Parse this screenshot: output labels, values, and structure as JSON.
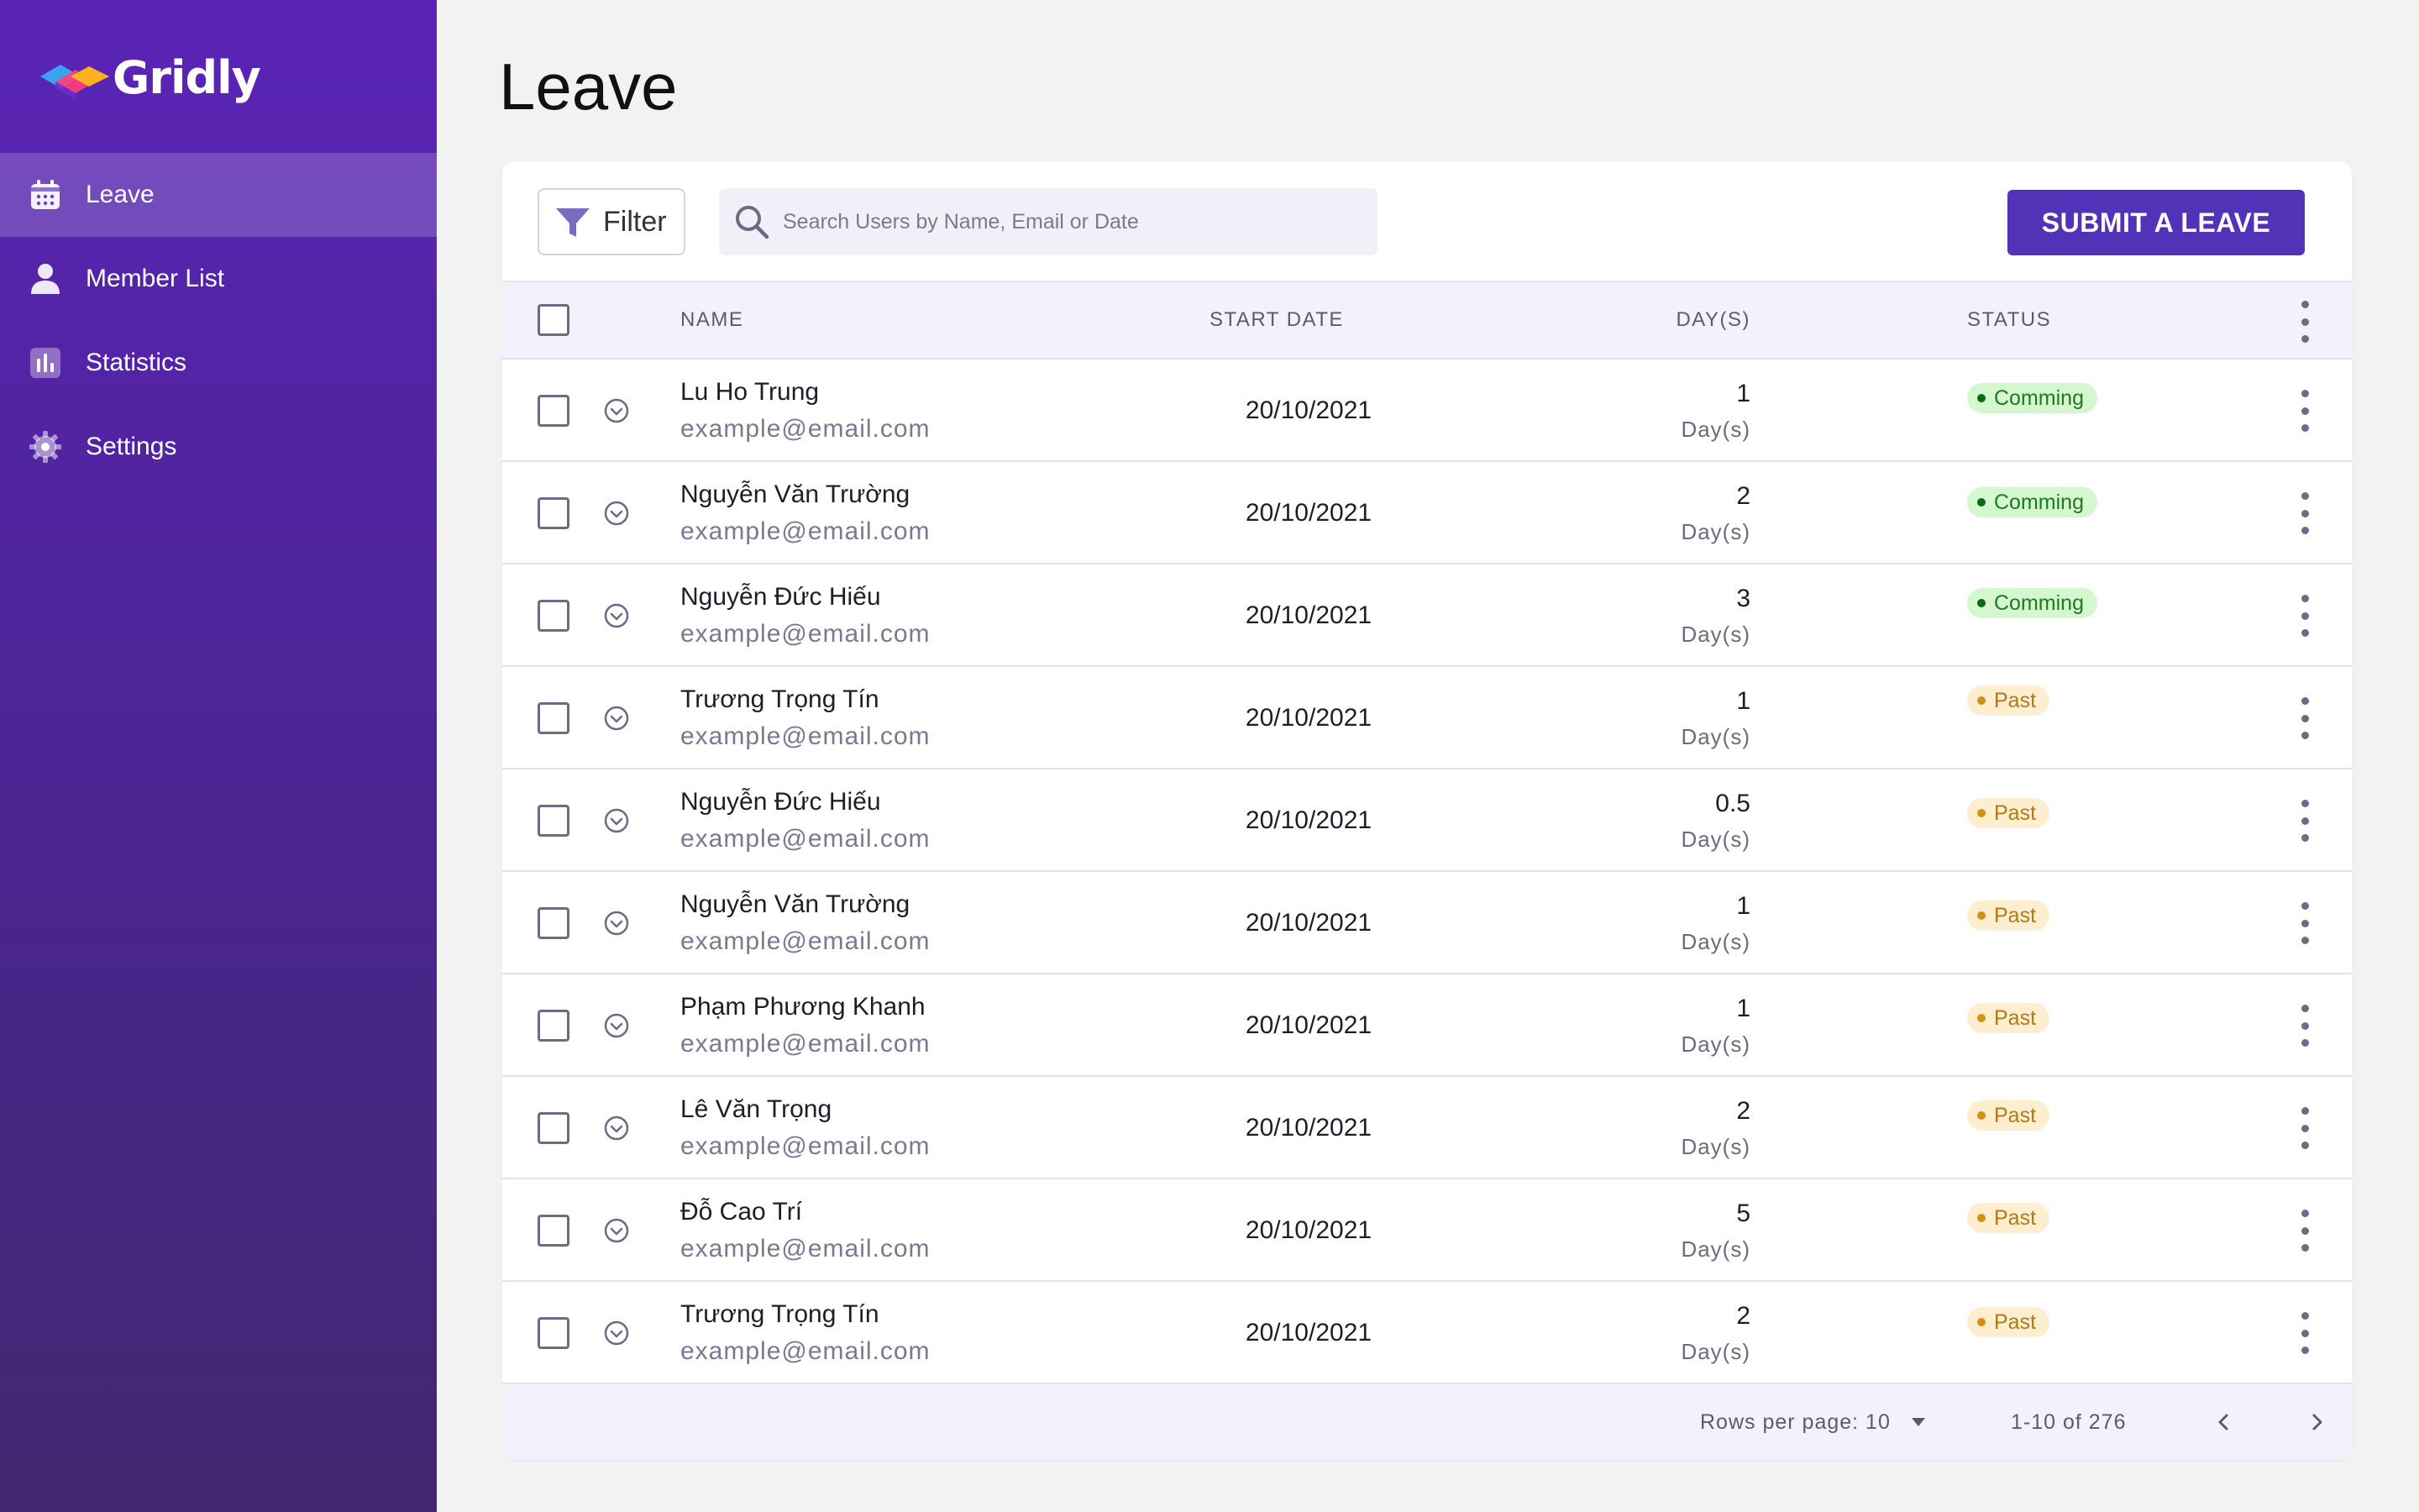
{
  "app": {
    "name": "Gridly"
  },
  "sidebar": {
    "items": [
      {
        "label": "Leave",
        "icon": "calendar-icon",
        "active": true
      },
      {
        "label": "Member List",
        "icon": "user-icon",
        "active": false
      },
      {
        "label": "Statistics",
        "icon": "bar-chart-icon",
        "active": false
      },
      {
        "label": "Settings",
        "icon": "gear-icon",
        "active": false
      }
    ]
  },
  "page": {
    "title": "Leave"
  },
  "toolbar": {
    "filter_label": "Filter",
    "search_placeholder": "Search Users by Name, Email or Date",
    "submit_label": "SUBMIT A LEAVE"
  },
  "table": {
    "columns": {
      "name": "NAME",
      "start_date": "START DATE",
      "days": "DAY(S)",
      "status": "STATUS"
    },
    "rows": [
      {
        "name": "Lu Ho Trung",
        "email": "example@email.com",
        "start_date": "20/10/2021",
        "days": "1",
        "days_unit": "Day(s)",
        "status": "Comming"
      },
      {
        "name": "Nguyễn Văn Trường",
        "email": "example@email.com",
        "start_date": "20/10/2021",
        "days": "2",
        "days_unit": "Day(s)",
        "status": "Comming"
      },
      {
        "name": "Nguyễn Đức Hiếu",
        "email": "example@email.com",
        "start_date": "20/10/2021",
        "days": "3",
        "days_unit": "Day(s)",
        "status": "Comming"
      },
      {
        "name": "Trương Trọng Tín",
        "email": "example@email.com",
        "start_date": "20/10/2021",
        "days": "1",
        "days_unit": "Day(s)",
        "status": "Past"
      },
      {
        "name": "Nguyễn Đức Hiếu",
        "email": "example@email.com",
        "start_date": "20/10/2021",
        "days": "0.5",
        "days_unit": "Day(s)",
        "status": "Past"
      },
      {
        "name": "Nguyễn Văn Trường",
        "email": "example@email.com",
        "start_date": "20/10/2021",
        "days": "1",
        "days_unit": "Day(s)",
        "status": "Past"
      },
      {
        "name": "Phạm Phương Khanh",
        "email": "example@email.com",
        "start_date": "20/10/2021",
        "days": "1",
        "days_unit": "Day(s)",
        "status": "Past"
      },
      {
        "name": "Lê Văn Trọng",
        "email": "example@email.com",
        "start_date": "20/10/2021",
        "days": "2",
        "days_unit": "Day(s)",
        "status": "Past"
      },
      {
        "name": "Đỗ Cao Trí",
        "email": "example@email.com",
        "start_date": "20/10/2021",
        "days": "5",
        "days_unit": "Day(s)",
        "status": "Past"
      },
      {
        "name": "Trương Trọng Tín",
        "email": "example@email.com",
        "start_date": "20/10/2021",
        "days": "2",
        "days_unit": "Day(s)",
        "status": "Past"
      }
    ]
  },
  "pagination": {
    "rows_per_page_label": "Rows per page: 10",
    "range_label": "1-10 of 276"
  },
  "colors": {
    "primary": "#5233b8",
    "sidebar_top": "#5a24b6",
    "sidebar_bottom": "#43276f",
    "status_comming": "#1d7a1f",
    "status_past": "#b0791a"
  }
}
